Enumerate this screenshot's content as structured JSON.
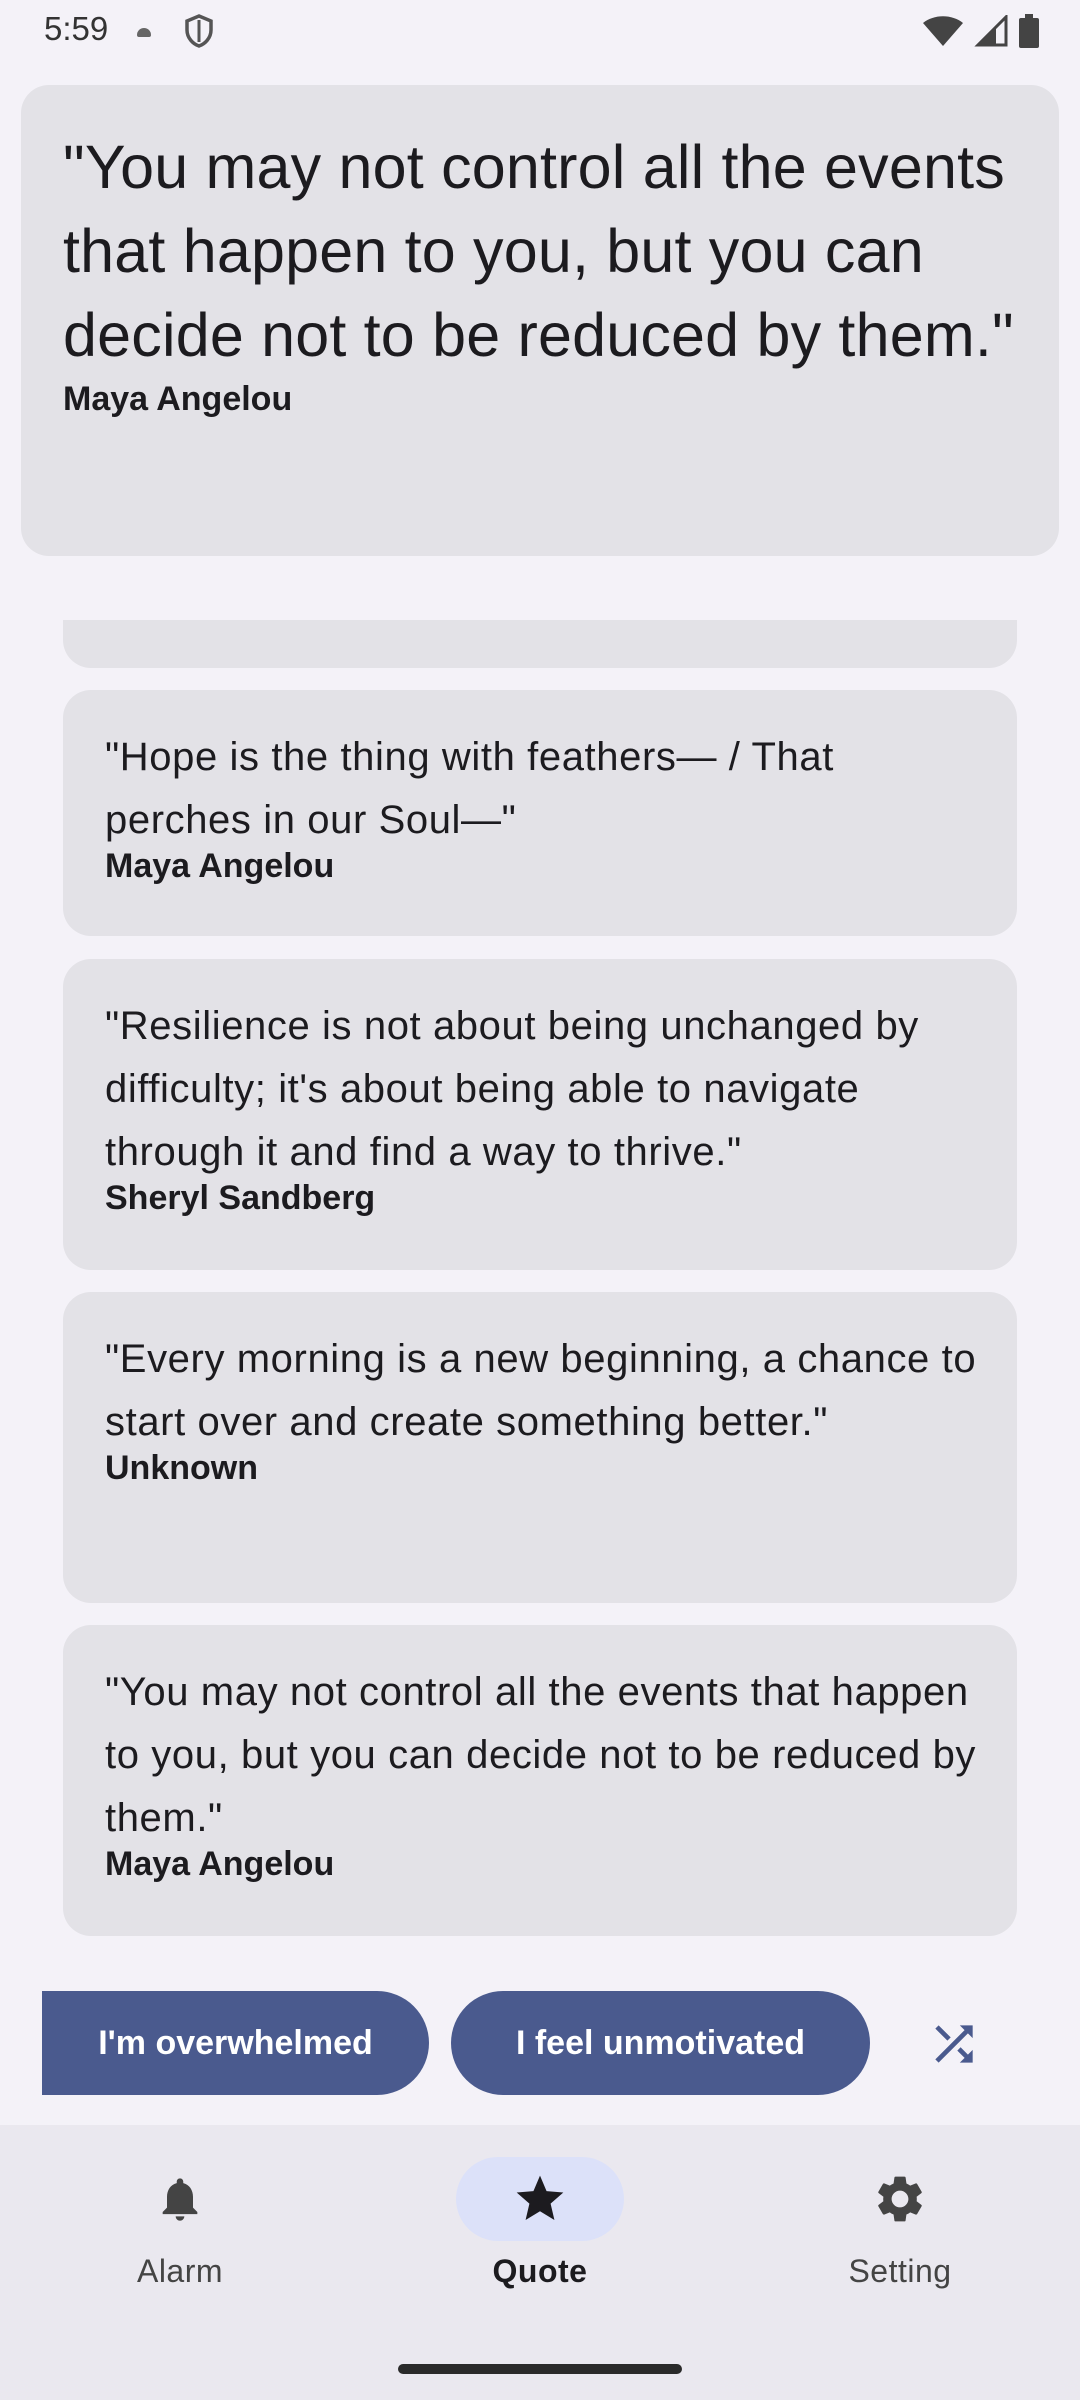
{
  "status": {
    "time": "5:59"
  },
  "featured": {
    "quote": "\"You may not control all the events that happen to you, but you can decide not to be reduced by them.\"",
    "author": "Maya Angelou"
  },
  "quotes": [
    {
      "quote": "\"Hope is the thing with feathers— / That perches in our Soul—\"",
      "author": "Maya Angelou"
    },
    {
      "quote": "\"Resilience is not about being unchanged by difficulty; it's about being able to navigate through it and find a way to thrive.\"",
      "author": "Sheryl Sandberg"
    },
    {
      "quote": "\"Every morning is a new beginning, a chance to start over and create something better.\"",
      "author": "Unknown"
    },
    {
      "quote": "\"You may not control all the events that happen to you, but you can decide not to be reduced by them.\"",
      "author": "Maya Angelou"
    }
  ],
  "chips": {
    "overwhelmed": "I'm overwhelmed",
    "unmotivated": "I feel unmotivated"
  },
  "nav": {
    "alarm": "Alarm",
    "quote": "Quote",
    "setting": "Setting",
    "active": "Quote"
  },
  "colors": {
    "accent": "#4a5a8e",
    "card": "#e3e2e7",
    "background": "#f4f2f8",
    "nav_active_pill": "#dce1f9"
  },
  "icons": {
    "alarm": "bell-icon",
    "quote": "star-icon",
    "setting": "gear-icon",
    "shuffle": "shuffle-icon"
  }
}
